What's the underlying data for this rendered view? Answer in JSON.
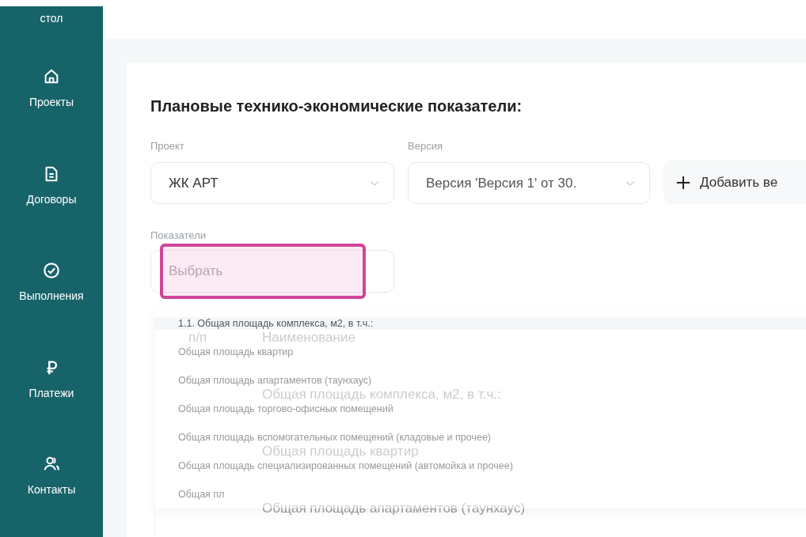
{
  "sidebar": {
    "items": [
      {
        "label": "стол",
        "kind": "plain"
      },
      {
        "label": "Проекты",
        "kind": "projects"
      },
      {
        "label": "Договоры",
        "kind": "contracts"
      },
      {
        "label": "Выполнения",
        "kind": "completions"
      },
      {
        "label": "Платежи",
        "kind": "payments"
      },
      {
        "label": "Контакты",
        "kind": "contacts"
      }
    ]
  },
  "title": "Плановые технико-экономические показатели:",
  "filters": [
    {
      "label": "Проект",
      "value": "ЖК АРТ"
    },
    {
      "label": "Версия",
      "value": "Версия 'Версия 1' от 30."
    }
  ],
  "add_button": {
    "label": "Добавить ве"
  },
  "indicators": {
    "label": "Показатели",
    "placeholder": "Выбрать",
    "highlighted": true
  },
  "dropdown": {
    "items": [
      {
        "label": "1.1. Общая площадь комплекса, м2, в т.ч.:",
        "selected": true
      },
      {
        "label": "Общая площадь квартир",
        "selected": false
      },
      {
        "label": "Общая площадь апартаментов (таунхаус)",
        "selected": false
      },
      {
        "label": "Общая площадь торгово-офисных помещений",
        "selected": false
      },
      {
        "label": "Общая площадь вспомогательных помещений (кладовые и прочее)",
        "selected": false
      },
      {
        "label": "Общая площадь специализированных помещений (автомойка и прочее)",
        "selected": false
      },
      {
        "label": "Общая пл",
        "selected": false
      }
    ]
  },
  "table": {
    "columns": [
      "п/п",
      "Наименование"
    ],
    "rows": [
      {
        "name": "Общая площадь комплекса, м2, в т.ч.:"
      },
      {
        "name": "Общая площадь квартир"
      },
      {
        "name": "Общая площадь апартаментов (таунхаус)"
      }
    ]
  }
}
